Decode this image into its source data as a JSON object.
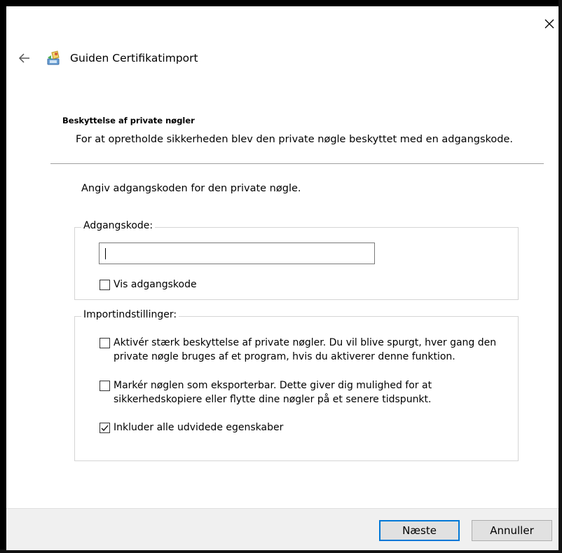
{
  "window": {
    "title": "Guiden Certifikatimport",
    "close_icon": "close-icon",
    "back_icon": "back-arrow-icon",
    "app_icon": "certificate-wizard-icon"
  },
  "header": {
    "title": "Beskyttelse af private nøgler",
    "subtitle": "For at opretholde sikkerheden blev den private nøgle beskyttet med en adgangskode."
  },
  "main": {
    "prompt": "Angiv adgangskoden for den private nøgle.",
    "password_group": {
      "legend": "Adgangskode:",
      "legend_access_key": "d",
      "password_value": "",
      "show_password": {
        "label": "Vis adgangskode",
        "checked": false
      }
    },
    "import_group": {
      "legend": "Importindstillinger:",
      "options": [
        {
          "line1": "Aktivér stærk beskyttelse af private nøgler. Du vil blive spurgt, hver gang den",
          "line2": "private nøgle bruges af et program, hvis du aktiverer denne funktion.",
          "checked": false
        },
        {
          "line1": "Markér nøglen som eksporterbar. Dette giver dig mulighed for at",
          "line2": "sikkerhedskopiere eller flytte dine nøgler på et senere tidspunkt.",
          "checked": false
        },
        {
          "line1": "Inkluder alle udvidede egenskaber",
          "line2": "",
          "checked": true
        }
      ]
    }
  },
  "footer": {
    "next_label": "Næste",
    "cancel_label": "Annuller"
  },
  "colors": {
    "accent": "#0078d7",
    "footer_bg": "#f0f0f0",
    "button_bg": "#e1e1e1"
  }
}
